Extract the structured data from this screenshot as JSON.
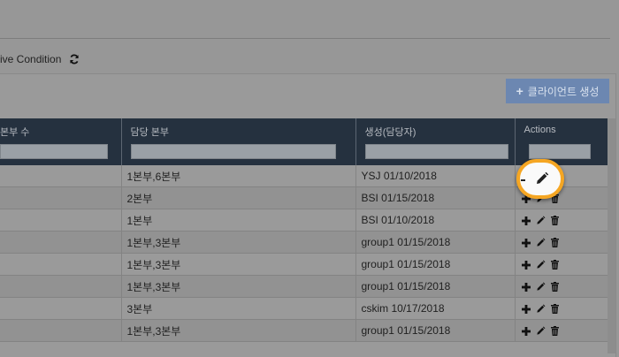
{
  "condition": {
    "label": "ive Condition",
    "refresh_icon": "refresh-icon"
  },
  "create_button": {
    "label": "클라이언트 생성",
    "icon": "plus-icon",
    "color": "#6c87b1"
  },
  "table": {
    "columns": [
      "본부 수",
      "담당 본부",
      "생성(담당자)",
      "Actions"
    ],
    "rows": [
      {
        "dept": "1본부,6본부",
        "created": "YSJ 01/10/2018"
      },
      {
        "dept": "2본부",
        "created": "BSI 01/15/2018"
      },
      {
        "dept": "1본부",
        "created": "BSI 01/10/2018"
      },
      {
        "dept": "1본부,3본부",
        "created": "group1 01/15/2018"
      },
      {
        "dept": "1본부,3본부",
        "created": "group1 01/15/2018"
      },
      {
        "dept": "1본부,3본부",
        "created": "group1 01/15/2018"
      },
      {
        "dept": "3본부",
        "created": "cskim 10/17/2018"
      },
      {
        "dept": "1본부,3본부",
        "created": "group1 01/15/2018"
      }
    ],
    "action_icons": [
      "plus-icon",
      "pencil-icon",
      "trash-icon"
    ]
  },
  "highlight": {
    "color": "#f5a623",
    "icon": "pencil-icon"
  },
  "header_color": "#25313f"
}
